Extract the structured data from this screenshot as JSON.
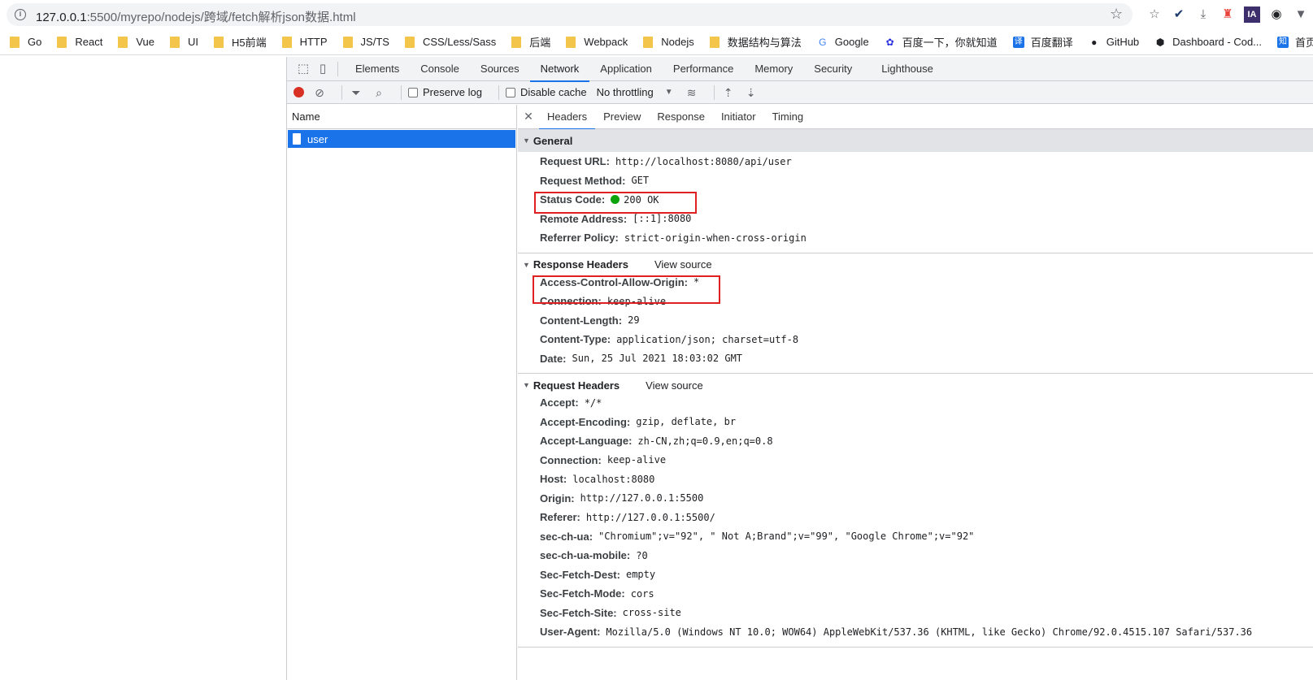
{
  "address_bar": {
    "url_host": "127.0.0.1",
    "url_rest": ":5500/myrepo/nodejs/跨域/fetch解析json数据.html"
  },
  "bookmarks": [
    {
      "label": "Go",
      "icon": "folder-icon"
    },
    {
      "label": "React",
      "icon": "folder-icon"
    },
    {
      "label": "Vue",
      "icon": "folder-icon"
    },
    {
      "label": "UI",
      "icon": "folder-icon"
    },
    {
      "label": "H5前端",
      "icon": "folder-icon"
    },
    {
      "label": "HTTP",
      "icon": "folder-icon"
    },
    {
      "label": "JS/TS",
      "icon": "folder-icon"
    },
    {
      "label": "CSS/Less/Sass",
      "icon": "folder-icon"
    },
    {
      "label": "后端",
      "icon": "folder-icon"
    },
    {
      "label": "Webpack",
      "icon": "folder-icon"
    },
    {
      "label": "Nodejs",
      "icon": "folder-icon"
    },
    {
      "label": "数据结构与算法",
      "icon": "folder-icon"
    },
    {
      "label": "Google",
      "icon": "google-icon"
    },
    {
      "label": "百度一下，你就知道",
      "icon": "baidu-icon"
    },
    {
      "label": "百度翻译",
      "icon": "translate-icon"
    },
    {
      "label": "GitHub",
      "icon": "github-icon"
    },
    {
      "label": "Dashboard - Cod...",
      "icon": "codepen-icon"
    },
    {
      "label": "首页 - 知乎",
      "icon": "zhihu-icon"
    }
  ],
  "devtools": {
    "tabs": [
      "Elements",
      "Console",
      "Sources",
      "Network",
      "Application",
      "Performance",
      "Memory",
      "Security",
      "Lighthouse"
    ],
    "active_tab": "Network",
    "toolbar": {
      "preserve_log": "Preserve log",
      "disable_cache": "Disable cache",
      "throttling": "No throttling"
    },
    "name_header": "Name",
    "request_name": "user",
    "detail_tabs": [
      "Headers",
      "Preview",
      "Response",
      "Initiator",
      "Timing"
    ],
    "general": {
      "title": "General",
      "rows": [
        {
          "key": "Request URL:",
          "value": "http://localhost:8080/api/user"
        },
        {
          "key": "Request Method:",
          "value": "GET"
        },
        {
          "key": "Status Code:",
          "value": "200 OK"
        },
        {
          "key": "Remote Address:",
          "value": "[::1]:8080"
        },
        {
          "key": "Referrer Policy:",
          "value": "strict-origin-when-cross-origin"
        }
      ]
    },
    "response_headers": {
      "title": "Response Headers",
      "view_source": "View source",
      "rows": [
        {
          "key": "Access-Control-Allow-Origin:",
          "value": "*"
        },
        {
          "key": "Connection:",
          "value": "keep-alive"
        },
        {
          "key": "Content-Length:",
          "value": "29"
        },
        {
          "key": "Content-Type:",
          "value": "application/json; charset=utf-8"
        },
        {
          "key": "Date:",
          "value": "Sun, 25 Jul 2021 18:03:02 GMT"
        }
      ]
    },
    "request_headers": {
      "title": "Request Headers",
      "view_source": "View source",
      "rows": [
        {
          "key": "Accept:",
          "value": "*/*"
        },
        {
          "key": "Accept-Encoding:",
          "value": "gzip, deflate, br"
        },
        {
          "key": "Accept-Language:",
          "value": "zh-CN,zh;q=0.9,en;q=0.8"
        },
        {
          "key": "Connection:",
          "value": "keep-alive"
        },
        {
          "key": "Host:",
          "value": "localhost:8080"
        },
        {
          "key": "Origin:",
          "value": "http://127.0.0.1:5500"
        },
        {
          "key": "Referer:",
          "value": "http://127.0.0.1:5500/"
        },
        {
          "key": "sec-ch-ua:",
          "value": "\"Chromium\";v=\"92\", \" Not A;Brand\";v=\"99\", \"Google Chrome\";v=\"92\""
        },
        {
          "key": "sec-ch-ua-mobile:",
          "value": "?0"
        },
        {
          "key": "Sec-Fetch-Dest:",
          "value": "empty"
        },
        {
          "key": "Sec-Fetch-Mode:",
          "value": "cors"
        },
        {
          "key": "Sec-Fetch-Site:",
          "value": "cross-site"
        },
        {
          "key": "User-Agent:",
          "value": "Mozilla/5.0 (Windows NT 10.0; WOW64) AppleWebKit/537.36 (KHTML, like Gecko) Chrome/92.0.4515.107 Safari/537.36"
        }
      ]
    }
  },
  "colors": {
    "accent": "#1a73e8",
    "highlight": "#e02020",
    "status_ok": "#0ca30c"
  }
}
